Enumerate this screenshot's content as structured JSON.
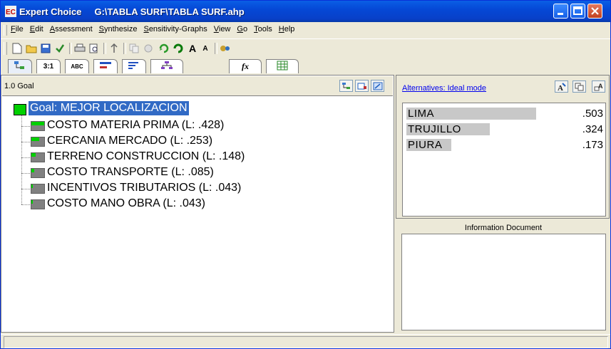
{
  "window": {
    "app_name": "Expert Choice",
    "file_path": "G:\\TABLA SURF\\TABLA SURF.ahp"
  },
  "menu": [
    "File",
    "Edit",
    "Assessment",
    "Synthesize",
    "Sensitivity-Graphs",
    "View",
    "Go",
    "Tools",
    "Help"
  ],
  "tabs": [
    {
      "icon": "tree-view-icon",
      "label": ""
    },
    {
      "icon": "",
      "label": "3:1"
    },
    {
      "icon": "",
      "label": "ABC"
    },
    {
      "icon": "bars-icon",
      "label": ""
    },
    {
      "icon": "list-bars-icon",
      "label": ""
    },
    {
      "icon": "hierarchy-icon",
      "label": ""
    },
    {
      "icon": "formula-icon",
      "label": "fx"
    },
    {
      "icon": "grid-icon",
      "label": ""
    }
  ],
  "left_pane": {
    "header_label": "1.0 Goal",
    "goal_text": "Goal: MEJOR LOCALIZACION",
    "criteria": [
      {
        "text": "COSTO MATERIA PRIMA (L: .428)",
        "weight": 0.428
      },
      {
        "text": "CERCANIA MERCADO (L: .253)",
        "weight": 0.253
      },
      {
        "text": "TERRENO CONSTRUCCION (L: .148)",
        "weight": 0.148
      },
      {
        "text": "COSTO TRANSPORTE (L: .085)",
        "weight": 0.085
      },
      {
        "text": "INCENTIVOS TRIBUTARIOS (L: .043)",
        "weight": 0.043
      },
      {
        "text": "COSTO MANO OBRA (L: .043)",
        "weight": 0.043
      }
    ]
  },
  "right_pane": {
    "alternatives_header": "Alternatives: Ideal mode",
    "alternatives": [
      {
        "name": "LIMA",
        "value": ".503",
        "score": 0.503
      },
      {
        "name": "TRUJILLO",
        "value": ".324",
        "score": 0.324
      },
      {
        "name": "PIURA",
        "value": ".173",
        "score": 0.173
      }
    ],
    "info_title": "Information Document"
  },
  "colors": {
    "titlebar": "#0548d6",
    "goal_highlight": "#316ac5",
    "priority_green": "#00d000",
    "node_gray": "#808080"
  }
}
